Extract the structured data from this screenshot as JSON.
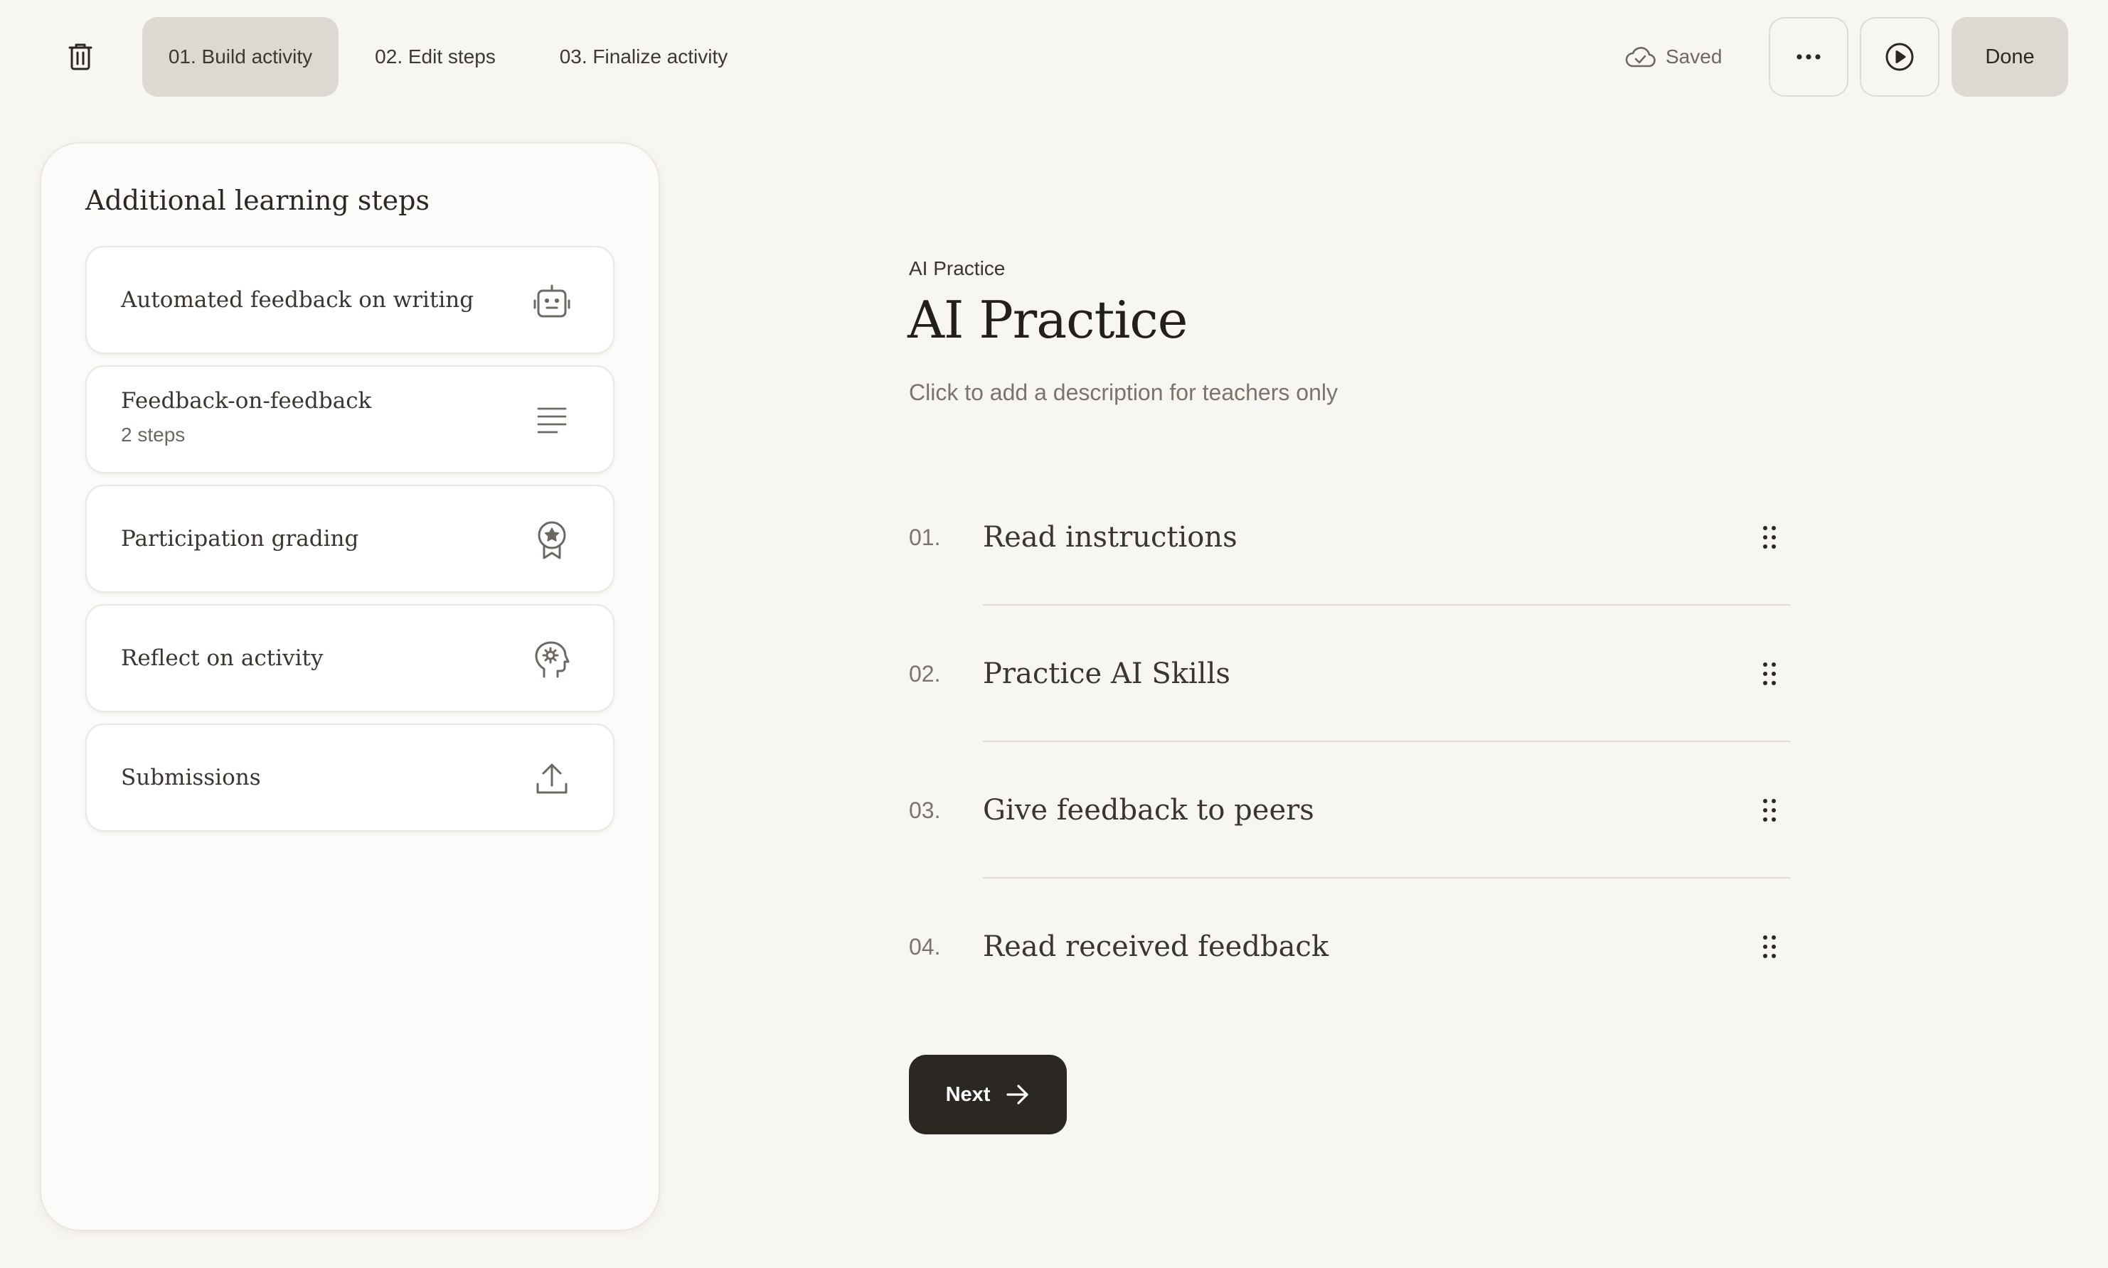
{
  "topbar": {
    "steps": [
      {
        "label": "01. Build activity",
        "active": true
      },
      {
        "label": "02. Edit steps",
        "active": false
      },
      {
        "label": "03. Finalize activity",
        "active": false
      }
    ],
    "saved_label": "Saved",
    "done_label": "Done",
    "icons": {
      "delete": "trash-icon",
      "saved": "cloud-check-icon",
      "more": "more-horizontal-icon",
      "preview": "play-circle-icon"
    }
  },
  "sidebar": {
    "title": "Additional learning steps",
    "items": [
      {
        "label": "Automated feedback on writing",
        "sub": "",
        "icon": "robot-icon"
      },
      {
        "label": "Feedback-on-feedback",
        "sub": "2 steps",
        "icon": "text-lines-icon"
      },
      {
        "label": "Participation grading",
        "sub": "",
        "icon": "award-badge-icon"
      },
      {
        "label": "Reflect on activity",
        "sub": "",
        "icon": "head-gear-icon"
      },
      {
        "label": "Submissions",
        "sub": "",
        "icon": "upload-icon"
      }
    ]
  },
  "main": {
    "eyebrow": "AI Practice",
    "title": "AI Practice",
    "description_placeholder": "Click to add a description for teachers only",
    "steps": [
      {
        "number": "01.",
        "name": "Read instructions"
      },
      {
        "number": "02.",
        "name": "Practice AI Skills"
      },
      {
        "number": "03.",
        "name": "Give feedback to peers"
      },
      {
        "number": "04.",
        "name": "Read received feedback"
      }
    ],
    "next_label": "Next"
  },
  "colors": {
    "background": "#f8f6f3",
    "active_tab": "#dcd8d2",
    "primary_button": "#2b2823",
    "text": "#2b2823",
    "muted_text": "#7a746b"
  }
}
